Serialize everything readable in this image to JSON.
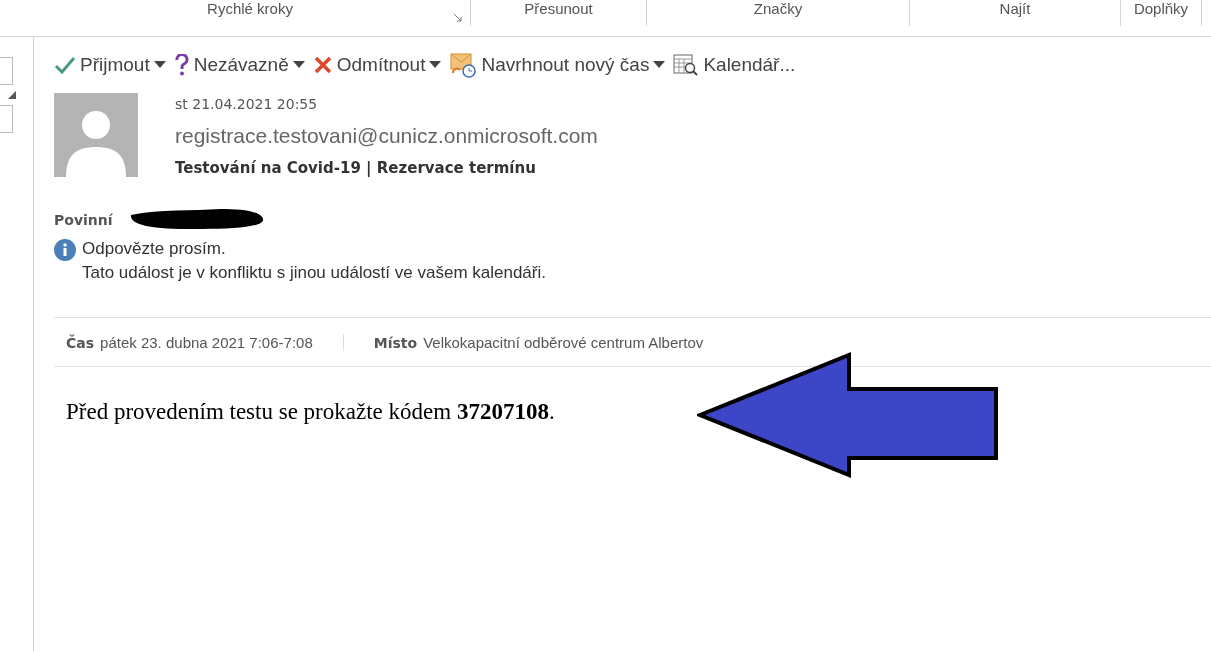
{
  "ribbon_groups": [
    {
      "label": "Rychlé kroky",
      "launcher": true
    },
    {
      "label": "Přesunout",
      "launcher": false
    },
    {
      "label": "Značky",
      "launcher": false
    },
    {
      "label": "Najít",
      "launcher": false
    },
    {
      "label": "Doplňky",
      "launcher": false
    }
  ],
  "actions": [
    {
      "kind": "accept",
      "label": "Přijmout",
      "dropdown": true
    },
    {
      "kind": "tentative",
      "label": "Nezávazně",
      "dropdown": true
    },
    {
      "kind": "decline",
      "label": "Odmítnout",
      "dropdown": true
    },
    {
      "kind": "propose",
      "label": "Navrhnout nový čas",
      "dropdown": true
    },
    {
      "kind": "calendar",
      "label": "Kalendář...",
      "dropdown": false
    }
  ],
  "message": {
    "date": "st 21.04.2021 20:55",
    "sender": "registrace.testovani@cunicz.onmicrosoft.com",
    "subject": "Testování na Covid-19 | Rezervace termínu",
    "required_label": "Povinní",
    "required_redacted": true
  },
  "info": {
    "lines": [
      "Odpovězte prosím.",
      "Tato událost je v konfliktu s jinou událostí ve vašem kalendáři."
    ]
  },
  "details": [
    {
      "label": "Čas",
      "value": "pátek 23. dubna 2021 7:06-7:08"
    },
    {
      "label": "Místo",
      "value": "Velkokapacitní odběrové centrum Albertov"
    }
  ],
  "body": "Před provedením testu se prokažte kódem **37207108**."
}
